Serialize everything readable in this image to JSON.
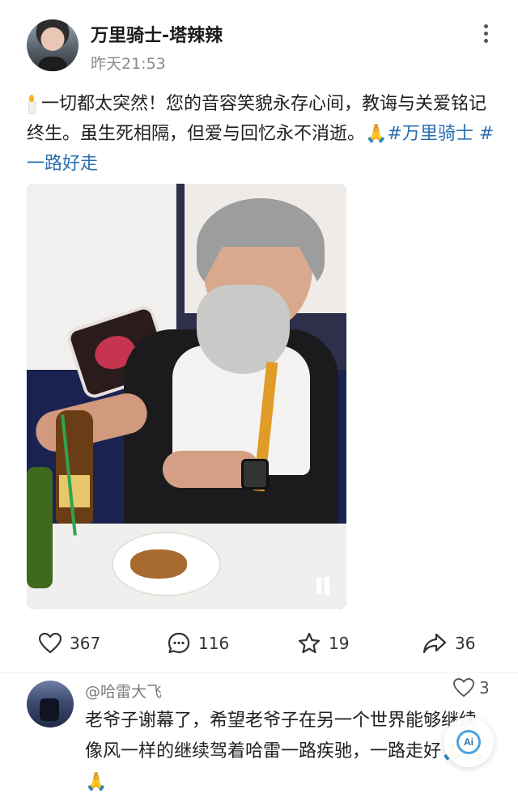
{
  "post": {
    "author": "万里骑士-塔辣辣",
    "time": "昨天21:53",
    "text_main": "一切都太突然！您的音容笑貌永存心间，教诲与关爱铭记终生。虽生死相隔，但爱与回忆永不消逝。",
    "pray_emoji": "🙏",
    "hashtag_1": "#万里骑士",
    "hashtag_2": "#一路好走"
  },
  "actions": {
    "likes": "367",
    "comments": "116",
    "favorites": "19",
    "shares": "36"
  },
  "comment": {
    "user": "@哈雷大飞",
    "likes": "3",
    "text": "老爷子谢幕了，希望老爷子在另一个世界能够继续像风一样的继续驾着哈雷一路疾驰，一路走好🙏🙏🙏"
  },
  "ai_badge": {
    "label": "Ai"
  },
  "colors": {
    "hashtag": "#2a6fb0",
    "text": "#1f1f1f",
    "muted": "#8a8a8a"
  }
}
